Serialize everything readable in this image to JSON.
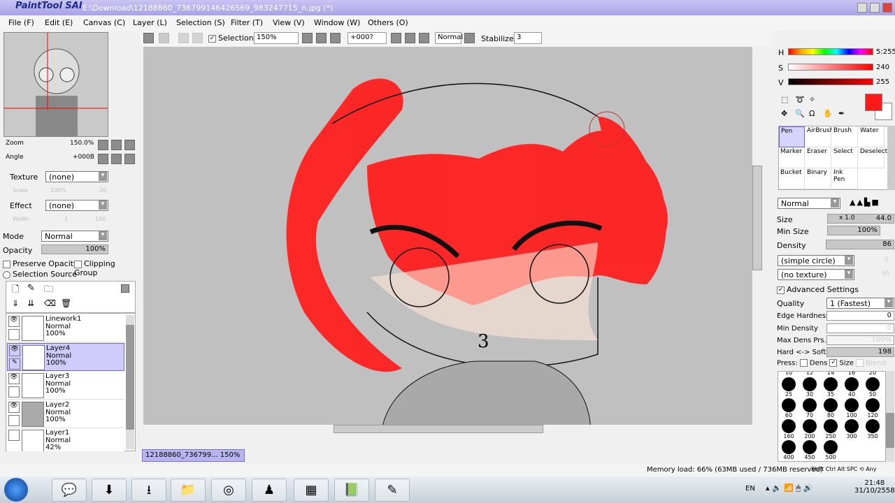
{
  "window": {
    "app_logo": "PaintTool SAI",
    "title": "E:\\Download\\12188860_736799146426569_983247715_n.jpg (*)"
  },
  "menu": [
    "File (F)",
    "Edit (E)",
    "Canvas (C)",
    "Layer (L)",
    "Selection (S)",
    "Filter (T)",
    "View (V)",
    "Window (W)",
    "Others (O)"
  ],
  "toolbar": {
    "selection_label": "Selection",
    "selection_checked": true,
    "zoom": "150%",
    "angle": "+000?",
    "blend": "Normal",
    "stabilizer_label": "Stabilizer",
    "stabilizer": "3"
  },
  "navigator": {
    "zoom_label": "Zoom",
    "zoom": "150.0%",
    "angle_label": "Angle",
    "angle": "+000B"
  },
  "layer_props": {
    "texture_label": "Texture",
    "texture": "(none)",
    "scale_label": "Scale",
    "scale": "100%",
    "scale_val": "20",
    "effect_label": "Effect",
    "effect": "(none)",
    "width_label": "Width",
    "width": "1",
    "width_val": "100",
    "mode_label": "Mode",
    "mode": "Normal",
    "opacity_label": "Opacity",
    "opacity": "100%",
    "preserve_opacity": "Preserve Opacity",
    "clipping_group": "Clipping Group",
    "selection_source": "Selection Source"
  },
  "layers": [
    {
      "name": "Linework1",
      "mode": "Normal",
      "opacity": "100%",
      "visible": true,
      "selected": false
    },
    {
      "name": "Layer4",
      "mode": "Normal",
      "opacity": "100%",
      "visible": true,
      "selected": true
    },
    {
      "name": "Layer3",
      "mode": "Normal",
      "opacity": "100%",
      "visible": true,
      "selected": false
    },
    {
      "name": "Layer2",
      "mode": "Normal",
      "opacity": "100%",
      "visible": true,
      "selected": false
    },
    {
      "name": "Layer1",
      "mode": "Normal",
      "opacity": "42%",
      "visible": false,
      "selected": false
    }
  ],
  "doc_tab": {
    "name": "12188860_736799...",
    "zoom": "150%"
  },
  "color": {
    "h_label": "H",
    "h": "5:255",
    "s_label": "S",
    "s": "240",
    "v_label": "V",
    "v": "255",
    "primary": "#ff1a1a"
  },
  "tools": [
    "Pen",
    "AirBrush",
    "Brush",
    "Water",
    "Marker",
    "Eraser",
    "Select",
    "Deselect",
    "Bucket",
    "Binary",
    "Ink Pen"
  ],
  "brush": {
    "blend": "Normal",
    "size_label": "Size",
    "size_mult": "x 1.0",
    "size": "44.0",
    "min_size_label": "Min Size",
    "min_size": "100%",
    "density_label": "Density",
    "density": "86",
    "shape": "(simple circle)",
    "shape_val": "0",
    "texture": "(no texture)",
    "texture_val": "95",
    "advanced": "Advanced Settings",
    "quality_label": "Quality",
    "quality": "1 (Fastest)",
    "edge_label": "Edge Hardness",
    "edge": "0",
    "min_density_label": "Min Density",
    "min_density": "0",
    "max_dens_label": "Max Dens Prs.",
    "max_dens": "100%",
    "hard_soft_label": "Hard <-> Soft",
    "hard_soft": "198",
    "press_label": "Press:",
    "press_dens": "Dens",
    "press_size": "Size",
    "press_blend": "Blend"
  },
  "brush_sizes_top": [
    "10",
    "12",
    "14",
    "16",
    "20"
  ],
  "brush_sizes": [
    "25",
    "30",
    "35",
    "40",
    "50",
    "60",
    "70",
    "80",
    "100",
    "120",
    "160",
    "200",
    "250",
    "300",
    "350",
    "400",
    "450",
    "500"
  ],
  "status": {
    "memory": "Memory load: 66% (63MB used / 736MB reserved)",
    "keys": [
      "Shift",
      "Ctrl",
      "Alt",
      "SPC",
      "Any"
    ]
  },
  "taskbar": {
    "apps": [
      "LINE",
      "SAI",
      "Download",
      "Explorer",
      "Chrome",
      "App",
      "Minecraft",
      "Reader",
      "SAI2"
    ],
    "lang": "EN",
    "time": "21:48",
    "date": "31/10/2558"
  }
}
